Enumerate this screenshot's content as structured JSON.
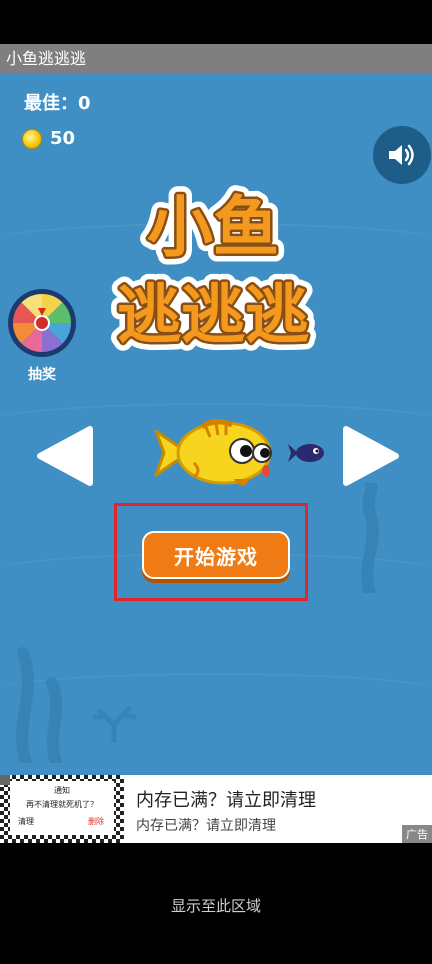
{
  "window": {
    "title": "小鱼逃逃逃"
  },
  "game": {
    "best_label": "最佳：0",
    "coins": "50",
    "logo_line1": "小鱼",
    "logo_line2": "逃逃逃",
    "lottery_label": "抽奖",
    "start_button": "开始游戏",
    "highlight_color": "#e0262a",
    "background_color": "#3f8fc4"
  },
  "ad": {
    "card_title": "通知",
    "card_message": "再不清理就死机了？",
    "card_btn_clear": "清理",
    "card_btn_delete": "删除",
    "title": "内存已满？请立即清理",
    "subtitle": "内存已满？请立即清理",
    "badge": "广告"
  },
  "footer": {
    "text": "显示至此区域"
  },
  "icons": [
    "speaker-icon",
    "coin-icon",
    "wheel-icon",
    "left-arrow-icon",
    "right-arrow-icon",
    "fish-icon"
  ]
}
